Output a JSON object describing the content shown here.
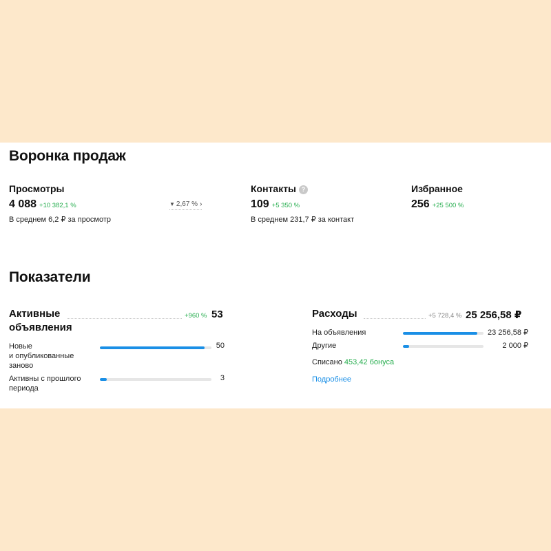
{
  "funnel": {
    "title": "Воронка продаж",
    "views": {
      "label": "Просмотры",
      "value": "4 088",
      "delta": "+10 382,1 %",
      "avg": "В среднем 6,2 ₽ за просмотр"
    },
    "conversion": {
      "value": "2,67 %",
      "icon": "filter-icon"
    },
    "contacts": {
      "label": "Контакты",
      "help": "?",
      "value": "109",
      "delta": "+5 350 %",
      "avg": "В среднем 231,7 ₽ за контакт"
    },
    "favorites": {
      "label": "Избранное",
      "value": "256",
      "delta": "+25 500 %"
    }
  },
  "indicators": {
    "title": "Показатели",
    "active": {
      "title_line1": "Активные",
      "title_line2": "объявления",
      "delta": "+960 %",
      "value": "53",
      "rows": [
        {
          "label_lines": [
            "Новые",
            "и опубликованные",
            "заново"
          ],
          "value": "50",
          "fill": 0.94
        },
        {
          "label_lines": [
            "Активны с прошлого",
            "периода"
          ],
          "value": "3",
          "fill": 0.06
        }
      ]
    },
    "expenses": {
      "title": "Расходы",
      "delta": "+5 728,4 %",
      "value": "25 256,58 ₽",
      "rows": [
        {
          "label": "На объявления",
          "value": "23 256,58 ₽",
          "fill": 0.92
        },
        {
          "label": "Другие",
          "value": "2 000 ₽",
          "fill": 0.08
        }
      ],
      "spent_prefix": "Списано",
      "spent_bonus": "453,42 бонуса",
      "more_link": "Подробнее"
    }
  },
  "colors": {
    "background": "#fde8cb",
    "card": "#ffffff",
    "positive": "#27ae4f",
    "accent": "#1a8fe6"
  }
}
